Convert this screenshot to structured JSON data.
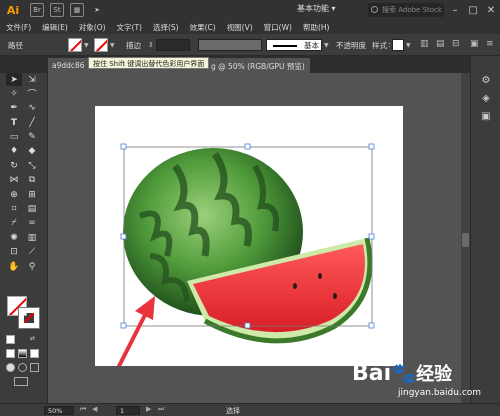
{
  "app": {
    "logo": "Ai",
    "br_icon": "Br",
    "st_icon": "St",
    "workspace": "基本功能",
    "stock_search_placeholder": "搜索 Adobe Stock"
  },
  "menu": [
    "文件(F)",
    "编辑(E)",
    "对象(O)",
    "文字(T)",
    "选择(S)",
    "效果(C)",
    "视图(V)",
    "窗口(W)",
    "帮助(H)"
  ],
  "control_bar": {
    "object_type": "路径",
    "stroke_label": "描边",
    "stroke_weight": "",
    "brush_label": "基本",
    "opacity_label": "不透明度",
    "style_label": "样式"
  },
  "tooltip": "按住 Shift 键调出替代色彩用户界面",
  "document_tab": {
    "name_start": "a9ddc86",
    "name_end": "g",
    "zoom_mode": "50% (RGB/GPU 预览)"
  },
  "status_bar": {
    "zoom": "50%",
    "page": "1",
    "status": "选择"
  },
  "watermark": {
    "logo_text": "Bai",
    "logo_text_2": "经验",
    "url": "jingyan.baidu.com"
  },
  "colors": {
    "accent_ai": "#ff9a00",
    "annotation_arrow": "#e8323c",
    "selection": "#4b7bd8"
  },
  "icons": [
    "selection-tool-icon",
    "direct-selection-tool-icon",
    "magic-wand-icon",
    "lasso-icon",
    "pen-tool-icon",
    "curvature-icon",
    "type-tool-icon",
    "line-tool-icon",
    "rectangle-tool-icon",
    "pencil-tool-icon",
    "paintbrush-icon",
    "eraser-icon",
    "rotate-tool-icon",
    "scale-tool-icon",
    "width-tool-icon",
    "free-transform-icon",
    "shape-builder-icon",
    "perspective-grid-icon",
    "mesh-tool-icon",
    "gradient-tool-icon",
    "eyedropper-icon",
    "blend-tool-icon",
    "symbol-sprayer-icon",
    "graph-tool-icon",
    "artboard-tool-icon",
    "slice-tool-icon",
    "hand-tool-icon",
    "zoom-tool-icon"
  ]
}
